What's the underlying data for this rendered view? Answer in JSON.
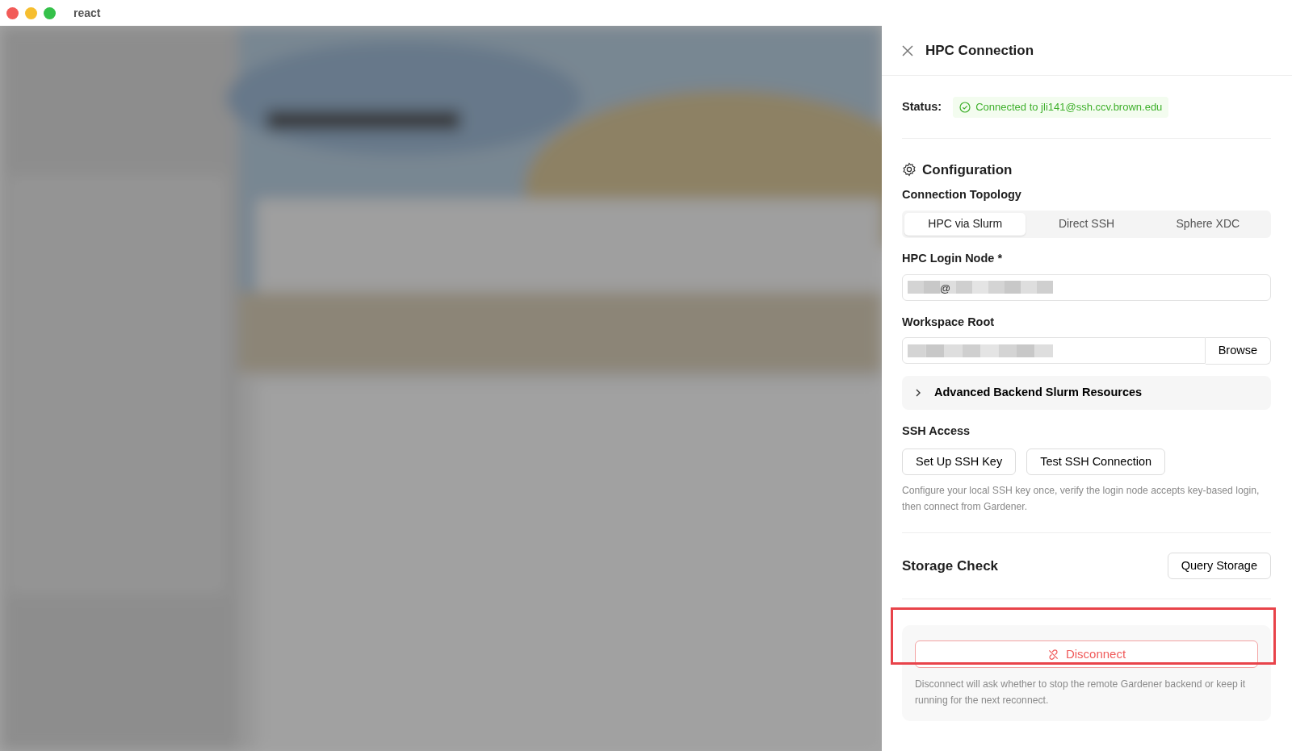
{
  "window": {
    "title": "react"
  },
  "drawer": {
    "title": "HPC Connection",
    "status": {
      "label": "Status:",
      "text": "Connected to jli141@ssh.ccv.brown.edu"
    },
    "configuration": {
      "title": "Configuration",
      "topology": {
        "label": "Connection Topology",
        "options": [
          {
            "label": "HPC via Slurm",
            "selected": true
          },
          {
            "label": "Direct SSH",
            "selected": false
          },
          {
            "label": "Sphere XDC",
            "selected": false
          }
        ]
      },
      "login_node": {
        "label": "HPC Login Node *",
        "visible_text": "@",
        "redacted": true
      },
      "workspace_root": {
        "label": "Workspace Root",
        "redacted": true,
        "button": "Browse"
      },
      "advanced": {
        "label": "Advanced Backend Slurm Resources",
        "expanded": false
      },
      "ssh_access": {
        "title": "SSH Access",
        "buttons": [
          "Set Up SSH Key",
          "Test SSH Connection"
        ],
        "help": "Configure your local SSH key once, verify the login node accepts key-based login, then connect from Gardener."
      }
    },
    "storage": {
      "title": "Storage Check",
      "button": "Query Storage"
    },
    "disconnect": {
      "button": "Disconnect",
      "help": "Disconnect will ask whether to stop the remote Gardener backend or keep it running for the next reconnect.",
      "highlighted": true
    }
  }
}
